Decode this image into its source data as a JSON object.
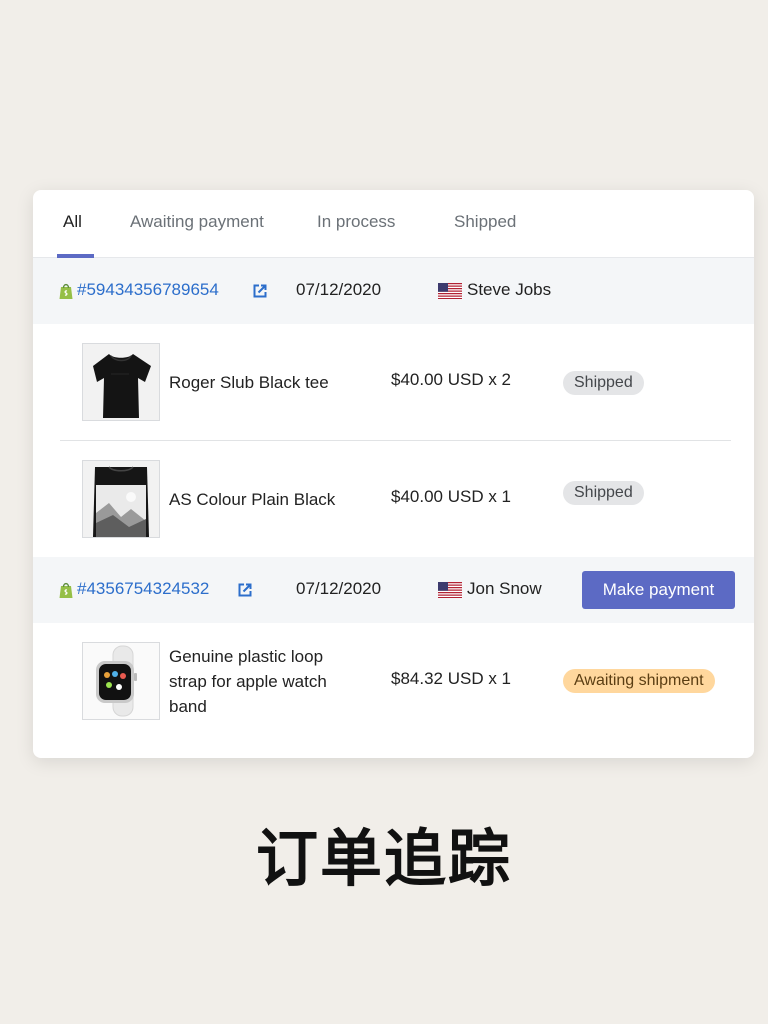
{
  "tabs": [
    {
      "label": "All",
      "active": true
    },
    {
      "label": "Awaiting payment",
      "active": false
    },
    {
      "label": "In process",
      "active": false
    },
    {
      "label": "Shipped",
      "active": false
    }
  ],
  "orders": [
    {
      "number": "#59434356789654",
      "date": "07/12/2020",
      "customer": "Steve Jobs",
      "country_flag": "us-flag-icon",
      "items": [
        {
          "name": "Roger Slub Black tee",
          "price": "$40.00 USD x 2",
          "status": "Shipped",
          "thumb_icon": "black-tshirt-image"
        },
        {
          "name": "AS Colour Plain Black",
          "price": "$40.00 USD x 1",
          "status": "Shipped",
          "thumb_icon": "black-print-tshirt-image"
        }
      ]
    },
    {
      "number": "#4356754324532",
      "date": "07/12/2020",
      "customer": "Jon Snow",
      "country_flag": "us-flag-icon",
      "action_label": "Make payment",
      "items": [
        {
          "name": "Genuine plastic loop strap for apple watch band",
          "price": "$84.32 USD x 1",
          "status": "Awaiting shipment",
          "thumb_icon": "apple-watch-image"
        }
      ]
    }
  ],
  "caption": "订单追踪",
  "colors": {
    "accent": "#5c6ac4",
    "link": "#2c6ecb",
    "shopify_green": "#95bf47",
    "awaiting_badge": "#ffd79d",
    "shipped_badge": "#e4e5e7",
    "background": "#f1eee9"
  }
}
